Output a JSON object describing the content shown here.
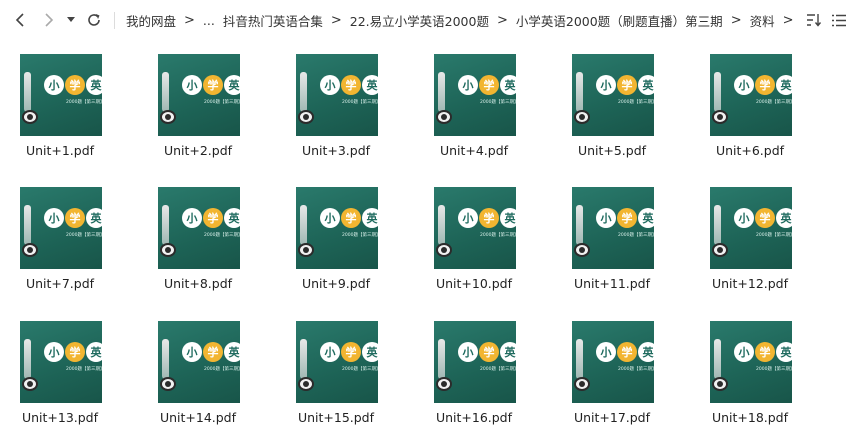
{
  "toolbar": {
    "back_icon": "chevron-left-icon",
    "forward_icon": "chevron-right-icon",
    "history_icon": "caret-down-icon",
    "refresh_icon": "refresh-icon",
    "sort_icon": "sort-icon",
    "view_icon": "list-view-icon"
  },
  "breadcrumb": {
    "items": [
      "我的网盘",
      "...",
      "抖音热门英语合集",
      "22.易立小学英语2000题",
      "小学英语2000题（刷题直播）第三期",
      "资料"
    ],
    "separator": ">"
  },
  "thumbnail": {
    "chars": [
      "小",
      "学",
      "英"
    ],
    "caption": "2000题【第三期】",
    "badge_icon": "pdf-icon",
    "colors": {
      "board": "#1f6b5f",
      "accent": "#f2b531",
      "badge": "#f3565d"
    }
  },
  "files": [
    {
      "name": "Unit+1.pdf"
    },
    {
      "name": "Unit+2.pdf"
    },
    {
      "name": "Unit+3.pdf"
    },
    {
      "name": "Unit+4.pdf"
    },
    {
      "name": "Unit+5.pdf"
    },
    {
      "name": "Unit+6.pdf"
    },
    {
      "name": "Unit+7.pdf"
    },
    {
      "name": "Unit+8.pdf"
    },
    {
      "name": "Unit+9.pdf"
    },
    {
      "name": "Unit+10.pdf"
    },
    {
      "name": "Unit+11.pdf"
    },
    {
      "name": "Unit+12.pdf"
    },
    {
      "name": "Unit+13.pdf"
    },
    {
      "name": "Unit+14.pdf"
    },
    {
      "name": "Unit+15.pdf"
    },
    {
      "name": "Unit+16.pdf"
    },
    {
      "name": "Unit+17.pdf"
    },
    {
      "name": "Unit+18.pdf"
    }
  ]
}
